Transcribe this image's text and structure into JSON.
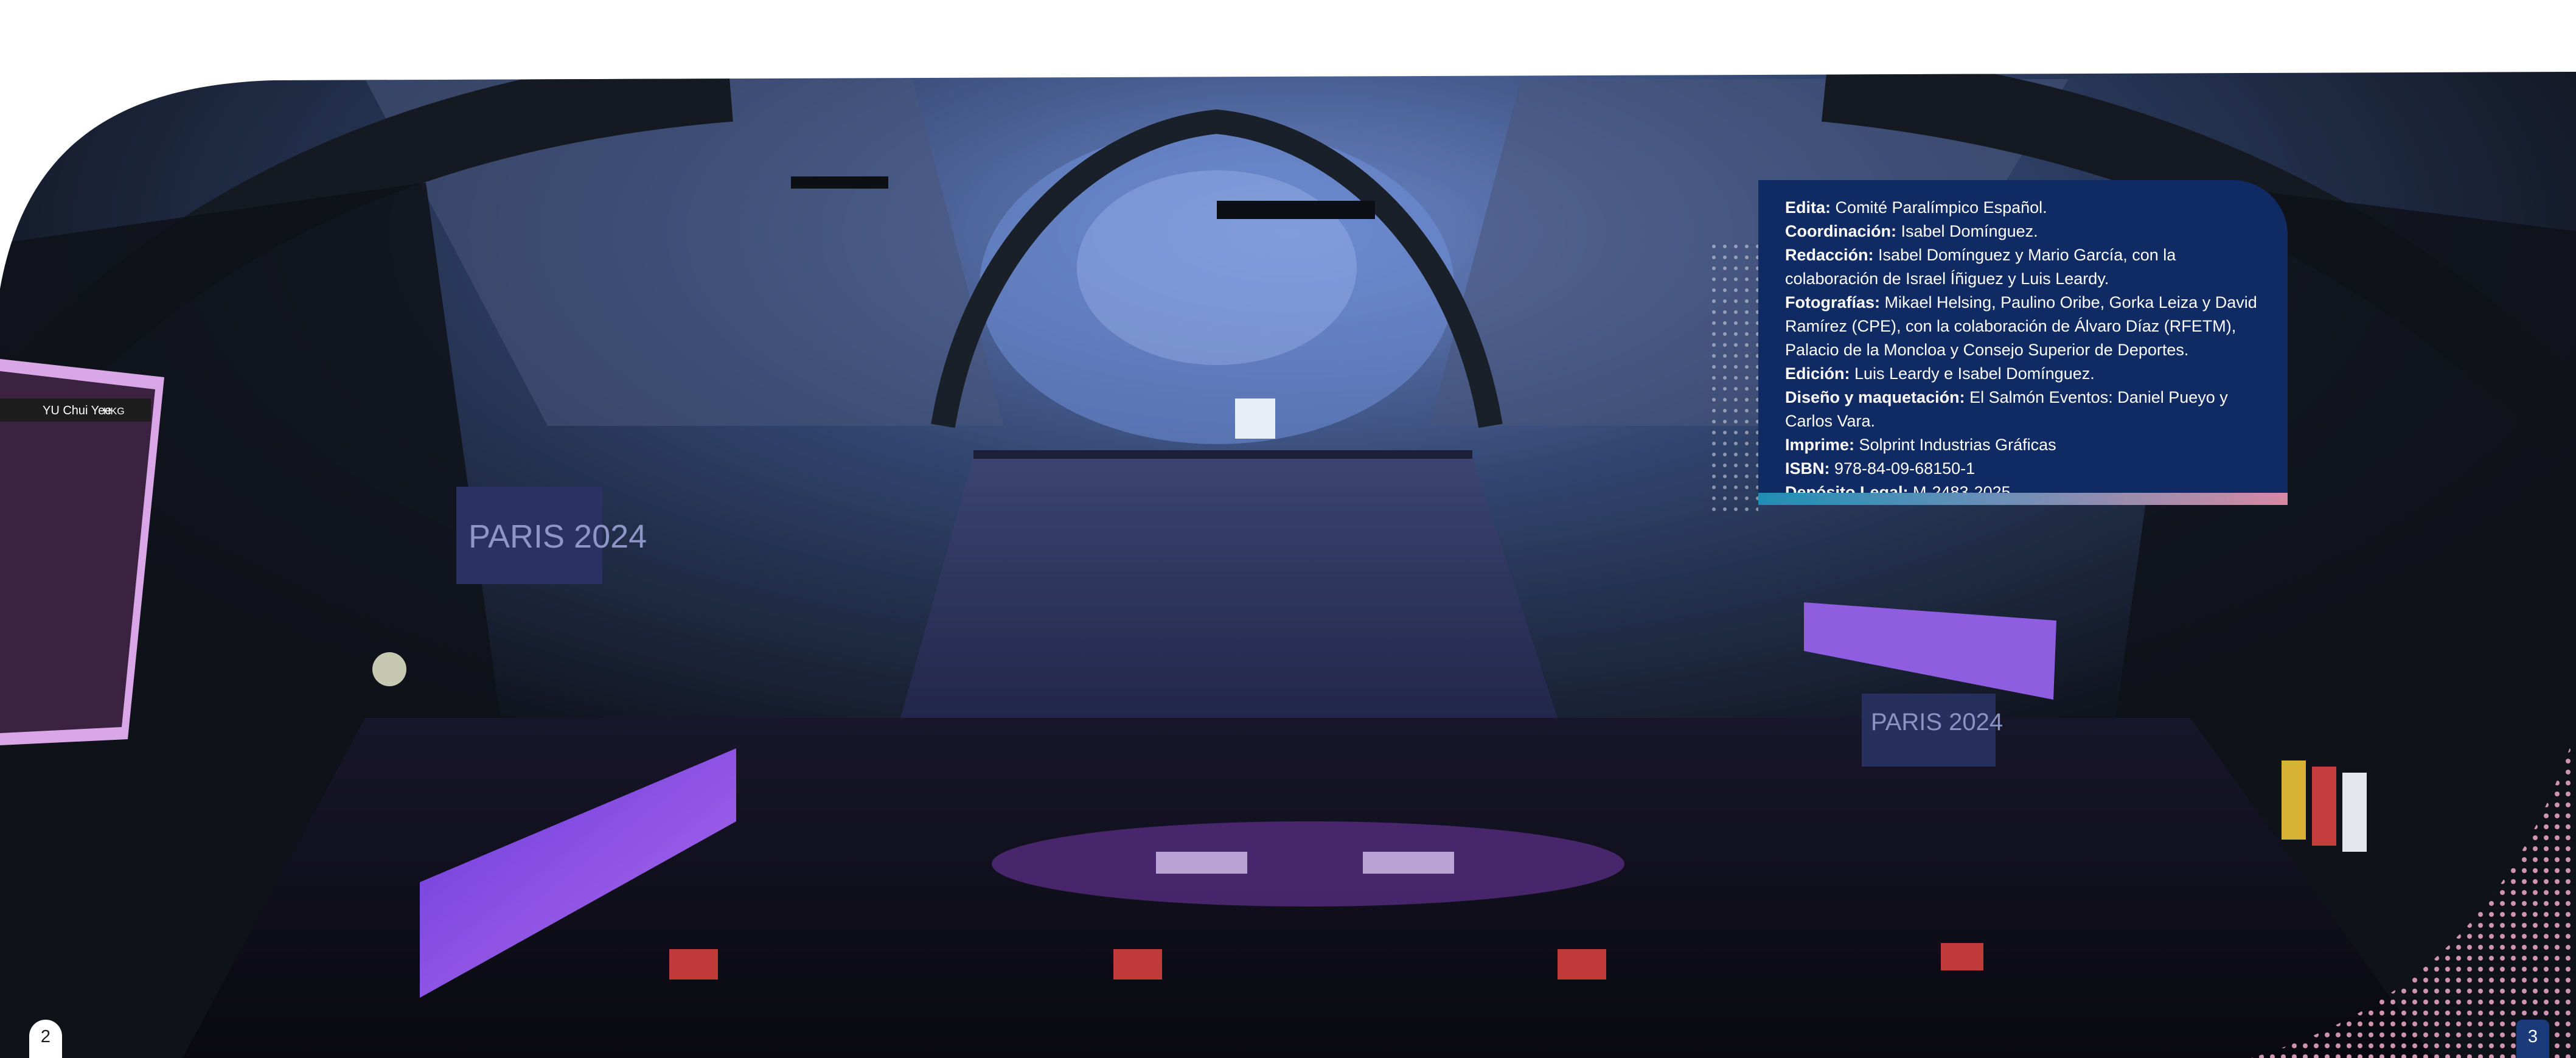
{
  "photo": {
    "screen_name": "YU Chui Yee",
    "screen_country": "HKG",
    "venue_banner": "PARIS 2024",
    "banner_text_2": "PARIS 2024"
  },
  "credits": [
    {
      "label": "Edita:",
      "value": " Comité Paralímpico Español."
    },
    {
      "label": "Coordinación:",
      "value": " Isabel Domínguez."
    },
    {
      "label": "Redacción:",
      "value": " Isabel Domínguez y Mario García, con la colaboración de Israel Íñiguez y Luis Leardy."
    },
    {
      "label": "Fotografías:",
      "value": " Mikael Helsing, Paulino Oribe, Gorka Leiza y David Ramírez (CPE), con la colaboración de Álvaro Díaz (RFETM), Palacio de la Moncloa y Consejo Superior de Deportes."
    },
    {
      "label": "Edición:",
      "value": " Luis Leardy e Isabel Domínguez."
    },
    {
      "label": "Diseño y maquetación:",
      "value": " El Salmón Eventos: Daniel Pueyo y Carlos Vara."
    },
    {
      "label": "Imprime:",
      "value": " Solprint Industrias Gráficas"
    },
    {
      "label": "ISBN:",
      "value": " 978-84-09-68150-1"
    },
    {
      "label": "Depósito Legal:",
      "value": " M-2483-2025"
    }
  ],
  "pages": {
    "left": "2",
    "right": "3"
  },
  "colors": {
    "panel": "#102a63",
    "accent_pink": "#d58aa2",
    "accent_blue": "#1f8fb5",
    "page_badge": "#1a3a7a"
  }
}
